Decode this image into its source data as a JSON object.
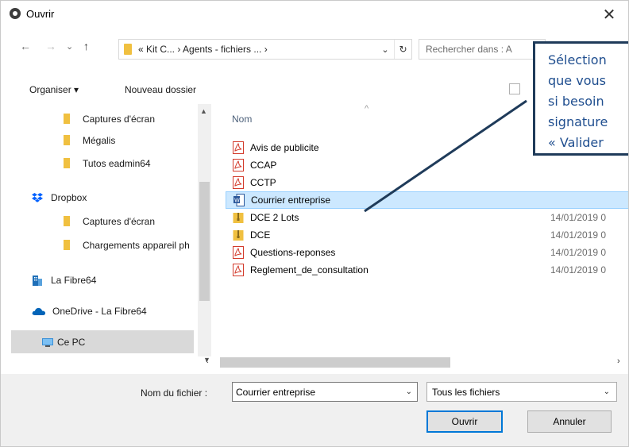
{
  "window": {
    "title": "Ouvrir",
    "close_glyph": "✕"
  },
  "nav": {
    "back_glyph": "←",
    "forward_glyph": "→",
    "recent_glyph": "⌄",
    "up_glyph": "↑",
    "breadcrumb": "«  Kit C...  ›  Agents - fichiers ...  ›",
    "dropdown_glyph": "⌄",
    "refresh_glyph": "↻",
    "search_placeholder": "Rechercher dans : A"
  },
  "toolbar": {
    "organize_label": "Organiser ▾",
    "new_folder_label": "Nouveau dossier"
  },
  "sidebar": {
    "items": [
      {
        "label": "Captures d'écran",
        "icon": "folder-icon"
      },
      {
        "label": "Mégalis",
        "icon": "folder-icon"
      },
      {
        "label": "Tutos eadmin64",
        "icon": "folder-icon"
      },
      {
        "label": "Dropbox",
        "icon": "dropbox-icon"
      },
      {
        "label": "Captures d'écran",
        "icon": "folder-icon"
      },
      {
        "label": "Chargements appareil ph",
        "icon": "folder-icon"
      },
      {
        "label": "La Fibre64",
        "icon": "building-icon"
      },
      {
        "label": "OneDrive - La Fibre64",
        "icon": "onedrive-icon"
      },
      {
        "label": "Ce PC",
        "icon": "computer-icon"
      }
    ]
  },
  "filelist": {
    "column_name": "Nom",
    "sort_glyph": "^",
    "files": [
      {
        "name": "Avis de publicite",
        "icon": "pdf-icon",
        "date": ""
      },
      {
        "name": "CCAP",
        "icon": "pdf-icon",
        "date": ""
      },
      {
        "name": "CCTP",
        "icon": "pdf-icon",
        "date": ""
      },
      {
        "name": "Courrier entreprise",
        "icon": "word-icon",
        "date": ""
      },
      {
        "name": "DCE 2 Lots",
        "icon": "zip-icon",
        "date": "14/01/2019 0"
      },
      {
        "name": "DCE",
        "icon": "zip-icon",
        "date": "14/01/2019 0"
      },
      {
        "name": "Questions-reponses",
        "icon": "pdf-icon",
        "date": "14/01/2019 0"
      },
      {
        "name": "Reglement_de_consultation",
        "icon": "pdf-icon",
        "date": "14/01/2019 0"
      }
    ]
  },
  "bottom": {
    "filename_label": "Nom du fichier :",
    "filename_value": "Courrier entreprise",
    "filetype_value": "Tous les fichiers",
    "open_label": "Ouvrir",
    "cancel_label": "Annuler"
  },
  "callout": {
    "lines": [
      "Sélection",
      "que vous",
      "si besoin",
      "signature",
      "« Valider"
    ]
  },
  "colors": {
    "selection": "#cce8ff",
    "callout_border": "#1f3b5a",
    "callout_text": "#1f4e8f",
    "pdf_red": "#d33b2c",
    "word_blue": "#2b579a"
  }
}
